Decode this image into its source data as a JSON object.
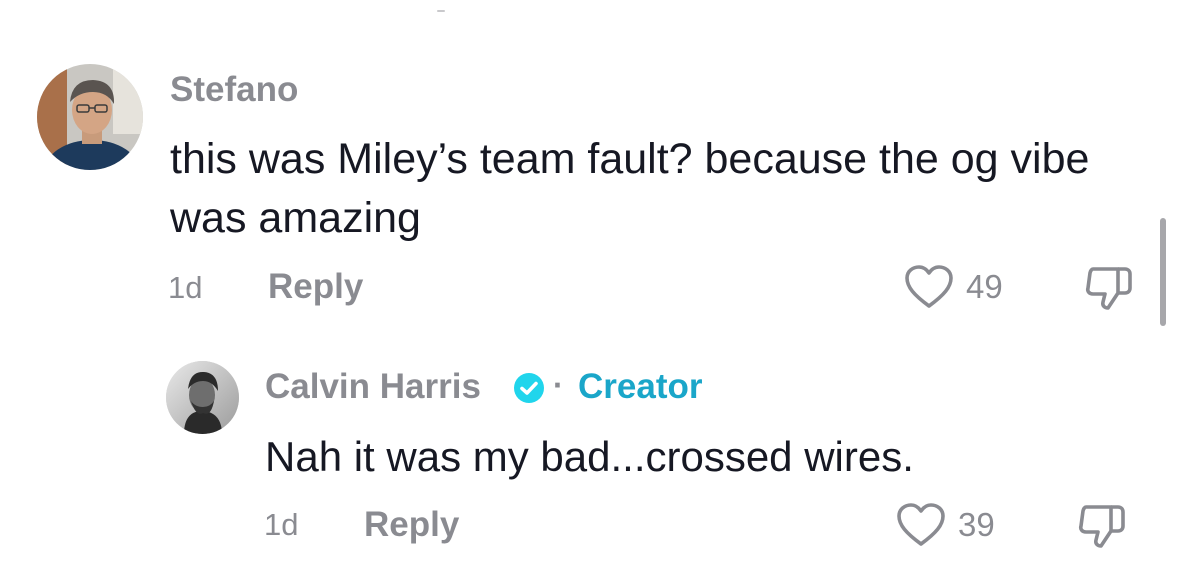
{
  "comments": [
    {
      "username": "Stefano",
      "text": "this was Miley’s team fault? because the og vibe was amazing",
      "time": "1d",
      "reply_label": "Reply",
      "likes": "49"
    },
    {
      "username": "Calvin Harris",
      "badge_label": "Creator",
      "separator": "·",
      "text": "Nah it was my bad...crossed wires.",
      "time": "1d",
      "reply_label": "Reply",
      "likes": "39",
      "verified_color": "#20d5ec"
    }
  ],
  "icons": {
    "like": "heart-outline-icon",
    "dislike": "thumbs-down-outline-icon",
    "verified": "verified-check-icon"
  },
  "colors": {
    "muted": "#8a8b91",
    "text": "#161823",
    "creator": "#1aa6c9"
  }
}
